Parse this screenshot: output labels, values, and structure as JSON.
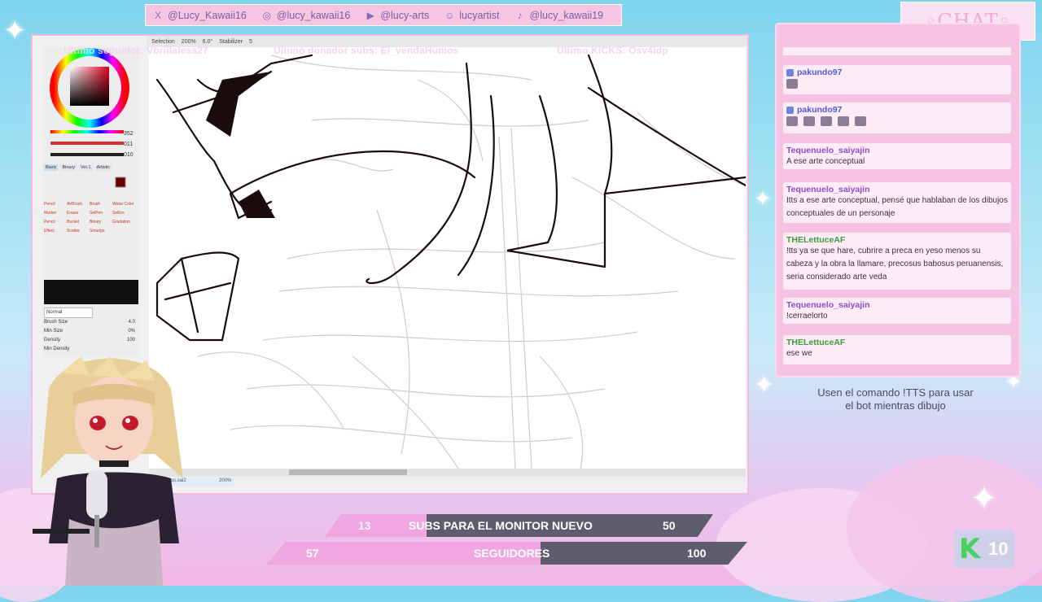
{
  "social": [
    {
      "icon": "x-icon",
      "glyph": "X",
      "label": "@Lucy_Kawaii16"
    },
    {
      "icon": "instagram-icon",
      "glyph": "◎",
      "label": "@lucy_kawaii16"
    },
    {
      "icon": "youtube-icon",
      "glyph": "▶",
      "label": "@lucy-arts"
    },
    {
      "icon": "discord-icon",
      "glyph": "☺",
      "label": "lucyartist"
    },
    {
      "icon": "tiktok-icon",
      "glyph": "♪",
      "label": "@lucy_kawaii19"
    }
  ],
  "chat": {
    "title": "◦CHAT◦",
    "messages": [
      {
        "user": "pakundo97",
        "color": "blue",
        "text": "",
        "emotes": 1
      },
      {
        "user": "pakundo97",
        "color": "blue",
        "text": "",
        "emotes": 5
      },
      {
        "user": "Tequenuelo_saiyajin",
        "color": "purple",
        "text": "A ese arte conceptual",
        "emotes": 0
      },
      {
        "user": "Tequenuelo_saiyajin",
        "color": "purple",
        "text": "Itts a ese arte conceptual, pensé que hablaban de los dibujos conceptuales de un personaje",
        "emotes": 0
      },
      {
        "user": "THELettuceAF",
        "color": "green",
        "text": "!tts ya se que hare, cubrire a preca en yeso menos su cabeza y la obra la llamare, precosus babosus peruanensis, seria considerado arte veda",
        "emotes": 0
      },
      {
        "user": "Tequenuelo_saiyajin",
        "color": "purple",
        "text": "!cerraelorto",
        "emotes": 0
      },
      {
        "user": "THELettuceAF",
        "color": "green",
        "text": "ese we",
        "emotes": 0
      }
    ],
    "tts_note": "Usen el comando !TTS para usar el bot mientras dibujo"
  },
  "paint": {
    "toolbar": [
      "Selection",
      "200%",
      "6.0°",
      "Stabilizer",
      "5"
    ],
    "overlay": {
      "seguidor": "Ultimo seguidor: Vbrillaless27",
      "donador": "Ultimo donador subs: El_vendaHumos",
      "kicks": "Ultimo KICKS: Osv4ldp"
    },
    "color_values": {
      "h": "352",
      "s": "011",
      "v": "010"
    },
    "tabs": [
      "Basic",
      "Binary",
      "Ver.1",
      "Artistic"
    ],
    "tools": [
      "Pencil",
      "AirBrush",
      "Brush",
      "Water Color",
      "Marker",
      "Eraser",
      "SelPen",
      "SelErs",
      "Pencil",
      "Bucket",
      "Binary",
      "Gradation",
      "Effect",
      "Scatter",
      "Smudge"
    ],
    "blend": "Normal",
    "brush_size": "4.0",
    "min_size": "0%",
    "density": "100",
    "min_density": "",
    "brush_size_label": "Brush Size",
    "min_size_label": "Min Size",
    "density_label": "Density",
    "min_density_label": "Min Density",
    "status_file": "...ss.sai2",
    "status_zoom": "200%"
  },
  "goals": {
    "subs": {
      "current": "13",
      "label": "SUBS PARA EL MONITOR NUEVO",
      "target": "50",
      "progress": 0.26
    },
    "followers": {
      "current": "57",
      "label": "SEGUIDORES",
      "target": "100",
      "progress": 0.57
    }
  },
  "kick": {
    "count": "10"
  },
  "colors": {
    "accent": "#f0a6e0",
    "panel": "#f6c4e2",
    "goal_bg": "#5d5d6e"
  }
}
